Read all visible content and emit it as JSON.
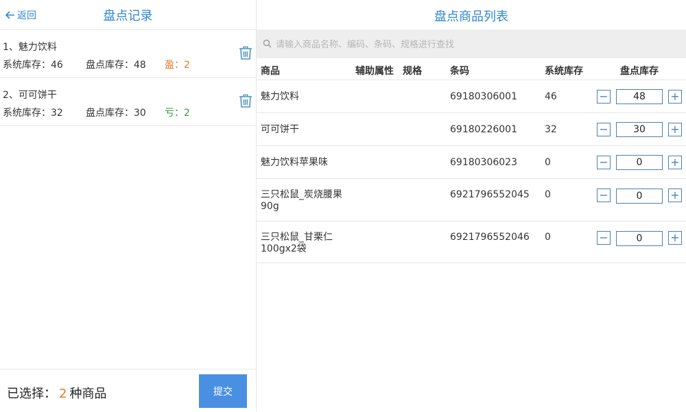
{
  "left": {
    "back_label": "返回",
    "title": "盘点记录",
    "records": [
      {
        "name": "1、魅力饮料",
        "sys": "系统库存：46",
        "count": "盘点库存：48",
        "diff": "盈：2",
        "diff_color": "#e87722"
      },
      {
        "name": "2、可可饼干",
        "sys": "系统库存：32",
        "count": "盘点库存：30",
        "diff": "亏：2",
        "diff_color": "#3a9a3a"
      }
    ],
    "footer": {
      "prefix": "已选择：",
      "count": "2",
      "suffix": "种商品",
      "submit_label": "提交"
    }
  },
  "right": {
    "title": "盘点商品列表",
    "search_placeholder": "请输入商品名称、编码、条码、规格进行查找",
    "columns": [
      "商品",
      "辅助属性",
      "规格",
      "条码",
      "系统库存",
      "盘点库存"
    ],
    "rows": [
      {
        "name": "魅力饮料",
        "barcode": "69180306001",
        "sys_stock": "46",
        "count": "48"
      },
      {
        "name": "可可饼干",
        "barcode": "69180226001",
        "sys_stock": "32",
        "count": "30"
      },
      {
        "name": "魅力饮料苹果味",
        "barcode": "69180306023",
        "sys_stock": "0",
        "count": "0"
      },
      {
        "name": "三只松鼠_炭烧腰果90g",
        "barcode": "6921796552045",
        "sys_stock": "0",
        "count": "0"
      },
      {
        "name": "三只松鼠_甘栗仁100gx2袋",
        "barcode": "6921796552046",
        "sys_stock": "0",
        "count": "0"
      }
    ],
    "minus_symbol": "−",
    "plus_symbol": "+"
  },
  "colors": {
    "accent": "#2e86d0",
    "gain": "#e87722",
    "loss": "#3a9a3a",
    "button": "#4a90e2"
  }
}
